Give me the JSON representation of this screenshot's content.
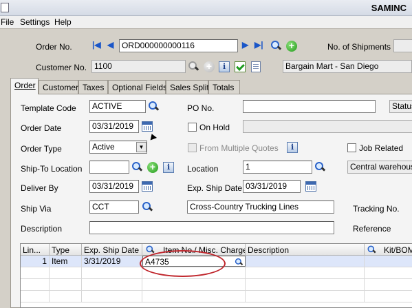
{
  "window": {
    "title": "SAMINC"
  },
  "menu": [
    "File",
    "Settings",
    "Help"
  ],
  "header": {
    "order_no_label": "Order No.",
    "order_no": "ORD000000000116",
    "shipments_label": "No. of Shipments",
    "shipments_value": "",
    "customer_no_label": "Customer No.",
    "customer_no": "1100",
    "customer_name": "Bargain Mart - San Diego"
  },
  "tabs": [
    "Order",
    "Customer",
    "Taxes",
    "Optional Fields",
    "Sales Split",
    "Totals"
  ],
  "active_tab": "Order",
  "form": {
    "template_code_label": "Template Code",
    "template_code": "ACTIVE",
    "po_no_label": "PO No.",
    "po_no": "",
    "status_label": "Status",
    "order_date_label": "Order Date",
    "order_date": "03/31/2019",
    "on_hold_label": "On Hold",
    "on_hold_reason": "",
    "order_type_label": "Order Type",
    "order_type": "Active",
    "from_multiple_quotes_label": "From Multiple Quotes",
    "job_related_label": "Job Related",
    "ship_to_location_label": "Ship-To Location",
    "ship_to_location": "",
    "location_label": "Location",
    "location": "1",
    "location_desc": "Central warehouse",
    "deliver_by_label": "Deliver By",
    "deliver_by": "03/31/2019",
    "exp_ship_date_label": "Exp. Ship Date",
    "exp_ship_date": "03/31/2019",
    "ship_via_label": "Ship Via",
    "ship_via": "CCT",
    "ship_via_desc": "Cross-Country Trucking Lines",
    "tracking_no_label": "Tracking No.",
    "description_label": "Description",
    "description": "",
    "reference_label": "Reference"
  },
  "grid": {
    "headers": [
      "Lin...",
      "Type",
      "Exp. Ship Date",
      "Item No./ Misc. Charge",
      "Description",
      "Kit/BOM"
    ],
    "rows": [
      {
        "line": "1",
        "type": "Item",
        "exp_ship_date": "3/31/2019",
        "item_no": "A4735",
        "description": ""
      }
    ]
  },
  "icons": {
    "nav_first": "first-record-icon",
    "nav_prev": "previous-record-icon",
    "nav_next": "next-record-icon",
    "nav_last": "last-record-icon",
    "finder": "magnifier-icon",
    "new": "add-new-icon",
    "calendar": "calendar-icon",
    "info": "info-icon",
    "approve": "green-check-icon",
    "document": "document-icon"
  },
  "colors": {
    "highlight": "#c0272d",
    "selected_row": "#dde6fa",
    "accent": "#1a56c8"
  }
}
